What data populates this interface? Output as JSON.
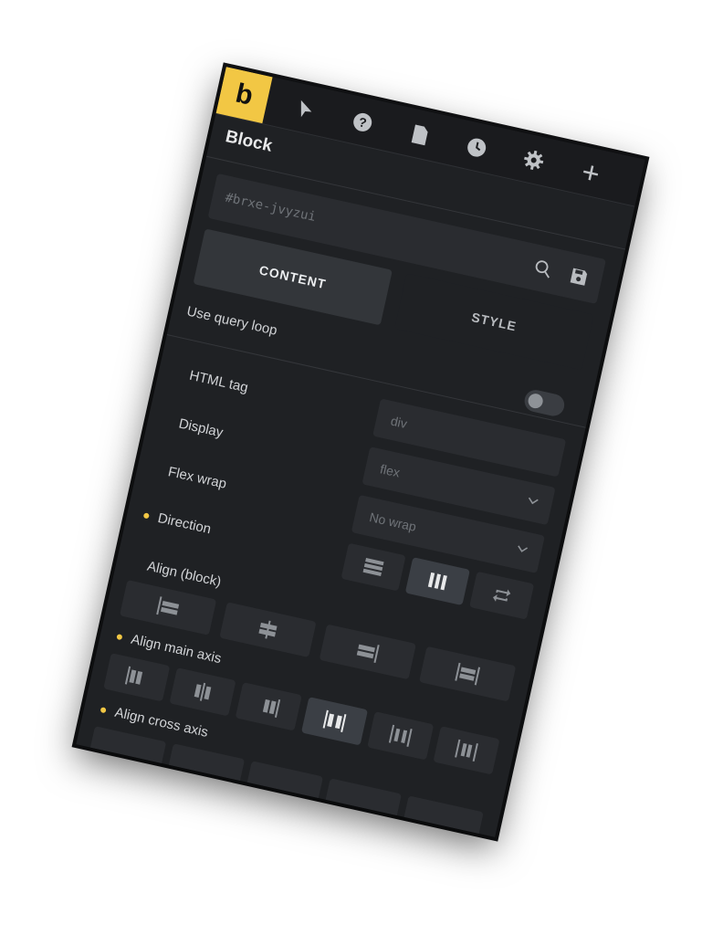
{
  "logo": {
    "letter": "b",
    "color": "#f2c744"
  },
  "toolbar": {
    "icons": [
      "cursor-icon",
      "help-icon",
      "page-icon",
      "history-icon",
      "settings-icon",
      "plus-icon"
    ]
  },
  "panel": {
    "title": "Block",
    "element_id": "#brxe-jvyzui",
    "tabs": [
      {
        "label": "CONTENT",
        "active": true
      },
      {
        "label": "STYLE",
        "active": false
      }
    ]
  },
  "fields": {
    "query_loop_label": "Use query loop",
    "html_tag_label": "HTML tag",
    "html_tag_value": "div",
    "display_label": "Display",
    "display_value": "flex",
    "flex_wrap_label": "Flex wrap",
    "flex_wrap_value": "No wrap",
    "direction_label": "Direction",
    "align_block_label": "Align (block)",
    "align_main_label": "Align main axis",
    "align_cross_label": "Align cross axis"
  },
  "colors": {
    "panel_bg": "#1f2124",
    "accent": "#f2c744",
    "field_bg": "#2a2c30"
  }
}
